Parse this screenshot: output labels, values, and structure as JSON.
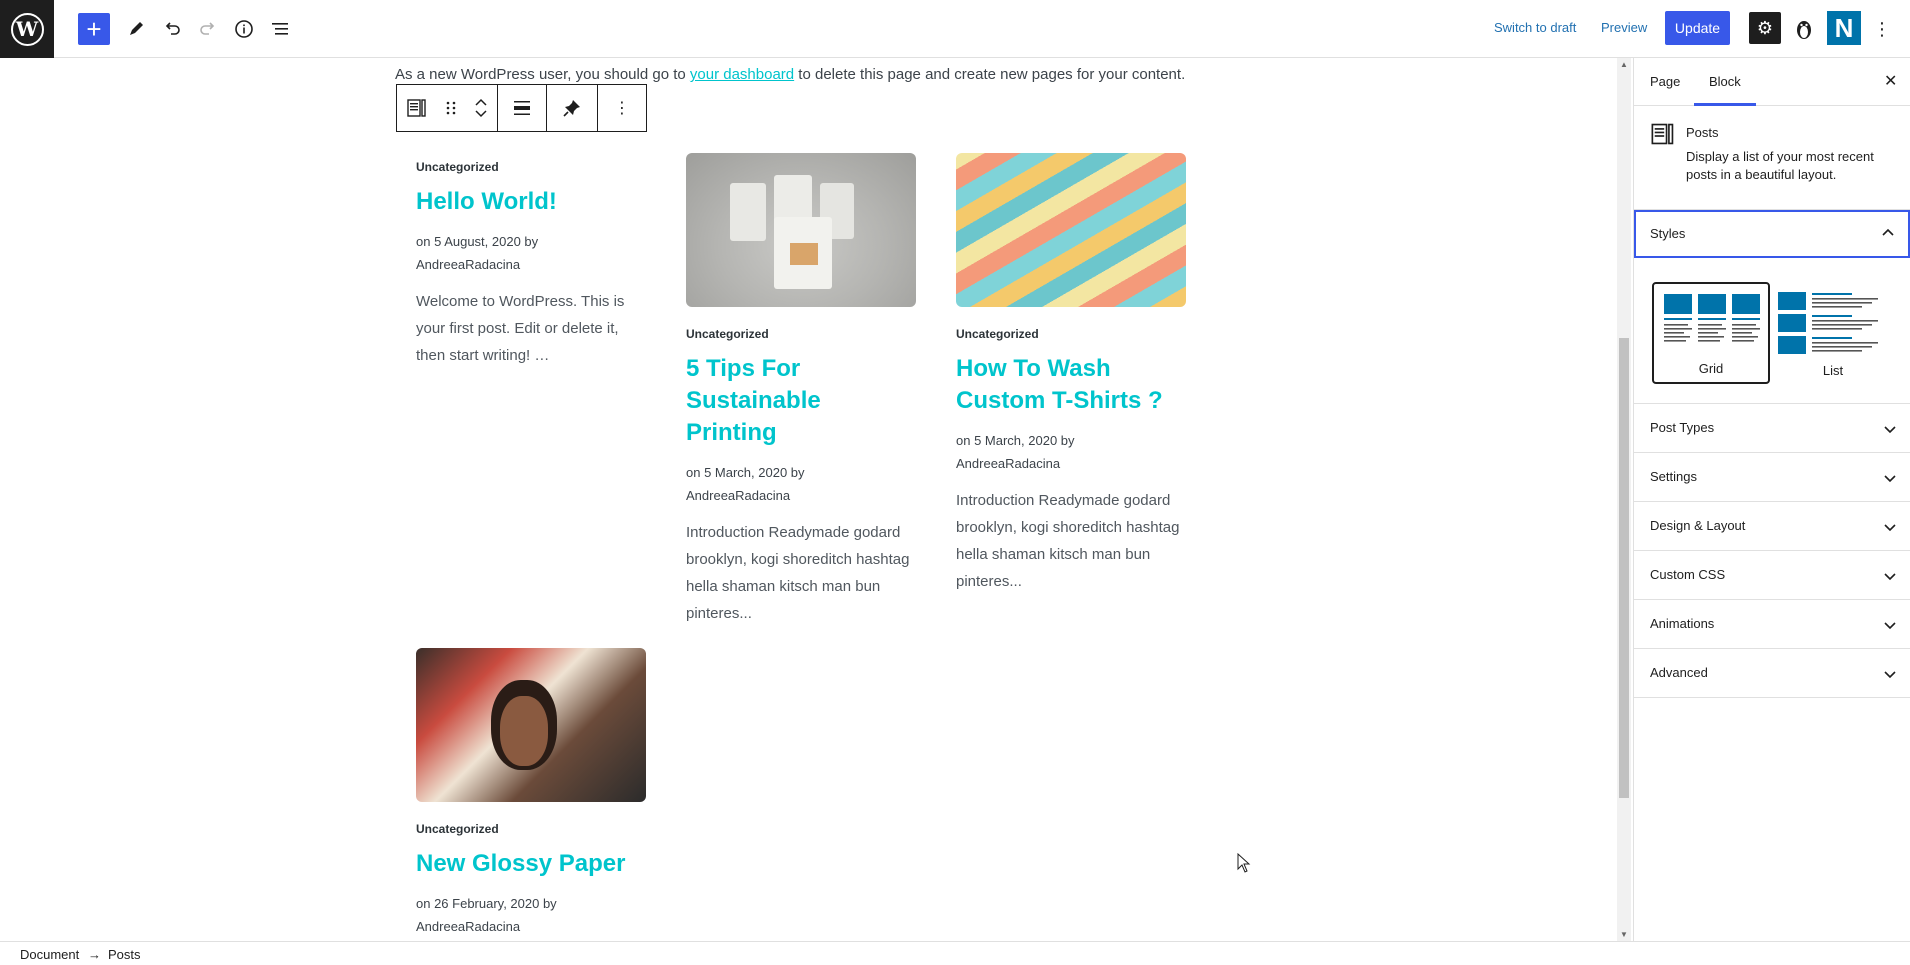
{
  "toolbar": {
    "switch_to_draft": "Switch to draft",
    "preview": "Preview",
    "update": "Update",
    "n_logo": "N"
  },
  "intro": {
    "before": "As a new WordPress user, you should go to ",
    "link": "your dashboard",
    "after": " to delete this page and create new pages for your content."
  },
  "posts": [
    {
      "category": "Uncategorized",
      "title": "Hello World!",
      "meta_date": "on 5 August, 2020 by",
      "meta_author": "AndreeaRadacina",
      "excerpt": "Welcome to WordPress. This is your first post. Edit or delete it, then start writing! …"
    },
    {
      "category": "Uncategorized",
      "title": "5 Tips For Sustainable Printing",
      "meta_date": "on 5 March, 2020 by",
      "meta_author": "AndreeaRadacina",
      "excerpt": "Introduction Readymade godard brooklyn, kogi shoreditch hashtag hella shaman kitsch man bun pinteres..."
    },
    {
      "category": "Uncategorized",
      "title": "How To Wash Custom T-Shirts ?",
      "meta_date": "on 5 March, 2020 by",
      "meta_author": "AndreeaRadacina",
      "excerpt": "Introduction Readymade godard brooklyn, kogi shoreditch hashtag hella shaman kitsch man bun pinteres..."
    },
    {
      "category": "Uncategorized",
      "title": "New Glossy Paper",
      "meta_date": "on 26 February, 2020 by",
      "meta_author": "AndreeaRadacina",
      "excerpt": ""
    }
  ],
  "sidebar": {
    "tabs": [
      "Page",
      "Block"
    ],
    "block_name": "Posts",
    "block_desc": "Display a list of your most recent posts in a beautiful layout.",
    "styles_label": "Styles",
    "style_options": [
      "Grid",
      "List"
    ],
    "panels": [
      "Post Types",
      "Settings",
      "Design & Layout",
      "Custom CSS",
      "Animations",
      "Advanced"
    ]
  },
  "breadcrumb": {
    "root": "Document",
    "sep": "→",
    "current": "Posts"
  },
  "colors": {
    "accent": "#3858e9",
    "title": "#00c4cc",
    "style_blue": "#0073aa"
  }
}
